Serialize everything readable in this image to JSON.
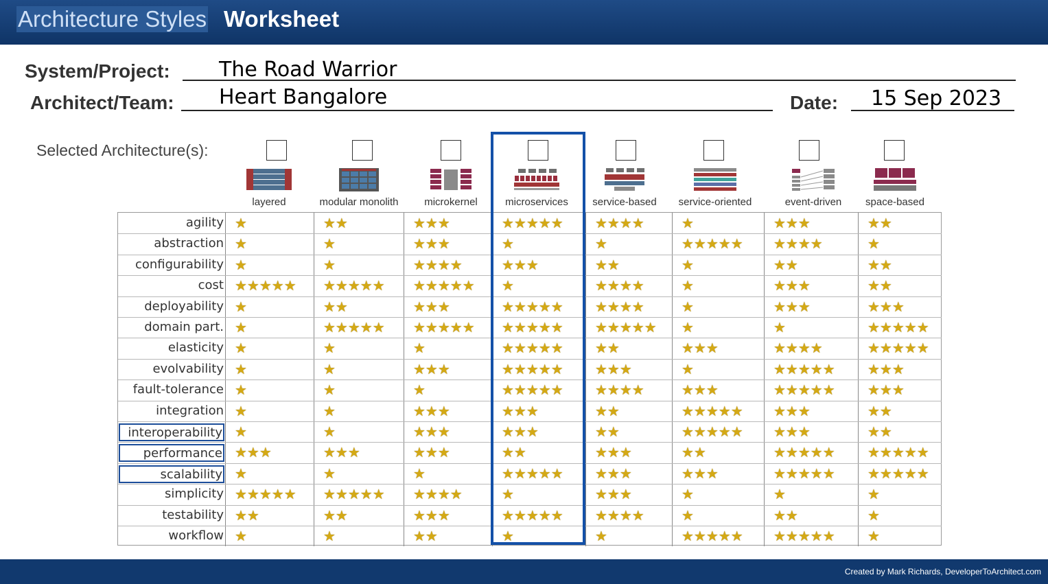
{
  "header": {
    "title_part1": "Architecture Styles",
    "title_part2": "Worksheet"
  },
  "form": {
    "project_label": "System/Project:",
    "project_value": "The Road Warrior",
    "team_label": "Architect/Team:",
    "team_value": "Heart Bangalore",
    "date_label": "Date:",
    "date_value": "15 Sep 2023"
  },
  "selection": {
    "label": "Selected Architecture(s):"
  },
  "architectures": [
    {
      "name": "layered",
      "icon": "layered-architecture-icon"
    },
    {
      "name": "modular monolith",
      "icon": "modular-monolith-icon"
    },
    {
      "name": "microkernel",
      "icon": "microkernel-icon"
    },
    {
      "name": "microservices",
      "icon": "microservices-icon"
    },
    {
      "name": "service-based",
      "icon": "service-based-icon"
    },
    {
      "name": "service-oriented",
      "icon": "service-oriented-icon"
    },
    {
      "name": "event-driven",
      "icon": "event-driven-icon"
    },
    {
      "name": "space-based",
      "icon": "space-based-icon"
    }
  ],
  "highlighted_architecture": "microservices",
  "characteristics": [
    {
      "name": "agility",
      "ratings": [
        1,
        2,
        3,
        5,
        4,
        1,
        3,
        2
      ]
    },
    {
      "name": "abstraction",
      "ratings": [
        1,
        1,
        3,
        1,
        1,
        5,
        4,
        1
      ]
    },
    {
      "name": "configurability",
      "ratings": [
        1,
        1,
        4,
        3,
        2,
        1,
        2,
        2
      ]
    },
    {
      "name": "cost",
      "ratings": [
        5,
        5,
        5,
        1,
        4,
        1,
        3,
        2
      ]
    },
    {
      "name": "deployability",
      "ratings": [
        1,
        2,
        3,
        5,
        4,
        1,
        3,
        3
      ]
    },
    {
      "name": "domain part.",
      "ratings": [
        1,
        5,
        5,
        5,
        5,
        1,
        1,
        5
      ]
    },
    {
      "name": "elasticity",
      "ratings": [
        1,
        1,
        1,
        5,
        2,
        3,
        4,
        5
      ]
    },
    {
      "name": "evolvability",
      "ratings": [
        1,
        1,
        3,
        5,
        3,
        1,
        5,
        3
      ]
    },
    {
      "name": "fault-tolerance",
      "ratings": [
        1,
        1,
        1,
        5,
        4,
        3,
        5,
        3
      ]
    },
    {
      "name": "integration",
      "ratings": [
        1,
        1,
        3,
        3,
        2,
        5,
        3,
        2
      ]
    },
    {
      "name": "interoperability",
      "ratings": [
        1,
        1,
        3,
        3,
        2,
        5,
        3,
        2
      ],
      "highlighted": true
    },
    {
      "name": "performance",
      "ratings": [
        3,
        3,
        3,
        2,
        3,
        2,
        5,
        5
      ],
      "highlighted": true
    },
    {
      "name": "scalability",
      "ratings": [
        1,
        1,
        1,
        5,
        3,
        3,
        5,
        5
      ],
      "highlighted": true
    },
    {
      "name": "simplicity",
      "ratings": [
        5,
        5,
        4,
        1,
        3,
        1,
        1,
        1
      ]
    },
    {
      "name": "testability",
      "ratings": [
        2,
        2,
        3,
        5,
        4,
        1,
        2,
        1
      ]
    },
    {
      "name": "workflow",
      "ratings": [
        1,
        1,
        2,
        1,
        1,
        5,
        5,
        1
      ]
    }
  ],
  "star_glyph": "★",
  "star_color": "#d4a915",
  "accent_color": "#1451a8",
  "footer": {
    "credit": "Created by Mark Richards, DeveloperToArchitect.com"
  }
}
